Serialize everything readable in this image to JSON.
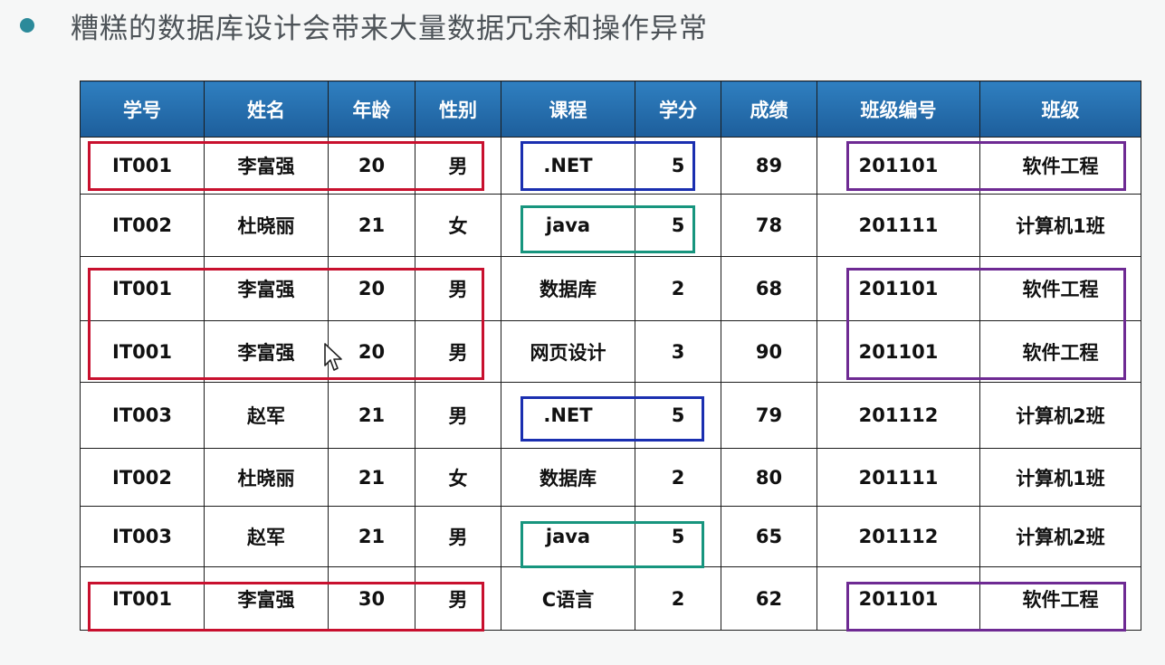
{
  "slide": {
    "title": "糟糕的数据库设计会带来大量数据冗余和操作异常"
  },
  "table": {
    "headers": [
      "学号",
      "姓名",
      "年龄",
      "性别",
      "课程",
      "学分",
      "成绩",
      "班级编号",
      "班级"
    ],
    "rows": [
      [
        "IT001",
        "李富强",
        "20",
        "男",
        ".NET",
        "5",
        "89",
        "201101",
        "软件工程"
      ],
      [
        "IT002",
        "杜晓丽",
        "21",
        "女",
        "java",
        "5",
        "78",
        "201111",
        "计算机1班"
      ],
      [
        "IT001",
        "李富强",
        "20",
        "男",
        "数据库",
        "2",
        "68",
        "201101",
        "软件工程"
      ],
      [
        "IT001",
        "李富强",
        "20",
        "男",
        "网页设计",
        "3",
        "90",
        "201101",
        "软件工程"
      ],
      [
        "IT003",
        "赵军",
        "21",
        "男",
        ".NET",
        "5",
        "79",
        "201112",
        "计算机2班"
      ],
      [
        "IT002",
        "杜晓丽",
        "21",
        "女",
        "数据库",
        "2",
        "80",
        "201111",
        "计算机1班"
      ],
      [
        "IT003",
        "赵军",
        "21",
        "男",
        "java",
        "5",
        "65",
        "201112",
        "计算机2班"
      ],
      [
        "IT001",
        "李富强",
        "30",
        "男",
        "C语言",
        "2",
        "62",
        "201101",
        "软件工程"
      ]
    ]
  },
  "colors": {
    "header_bg": "#1d5e9b",
    "bullet": "#2b8a9a",
    "highlight_red": "#c8102e",
    "highlight_blue": "#1a2fb0",
    "highlight_teal": "#17957e",
    "highlight_purple": "#6e2a93"
  },
  "icons": [
    "bullet-icon",
    "mouse-cursor-icon"
  ]
}
